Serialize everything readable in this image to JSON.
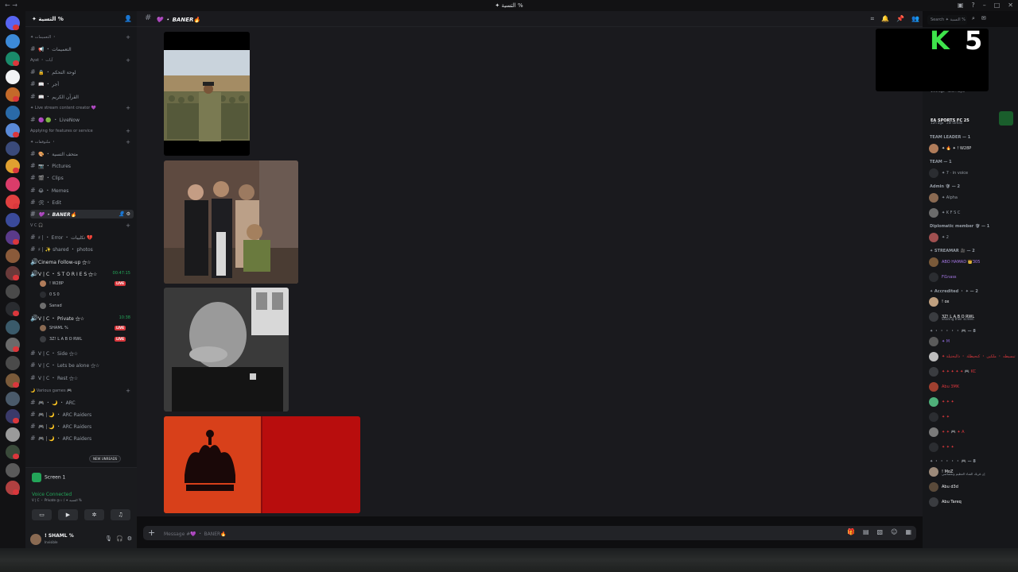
{
  "app": {
    "window_title": "✦ التسية %",
    "colors": {
      "online": "#23a559",
      "live": "#da373c",
      "bg": "#1a1a1e",
      "accent": "#5865f2"
    }
  },
  "server": {
    "name": "✦ التسية %"
  },
  "channels": [
    {
      "kind": "cat",
      "label": "✦ التعميمات ・"
    },
    {
      "kind": "ch",
      "label": "📢 ・ التعميمات"
    },
    {
      "kind": "cat",
      "label": "Ayat ・ آيات"
    },
    {
      "kind": "ch",
      "label": "🔒 ・ لوحة التحكم"
    },
    {
      "kind": "ch",
      "label": "📖 ・ أجر"
    },
    {
      "kind": "ch",
      "label": "📖 ・ القرآن الكريم"
    },
    {
      "kind": "cat",
      "label": "✦ Live stream content creator 💜"
    },
    {
      "kind": "ch",
      "label": "🟣 🟢 ・ LiveNow"
    },
    {
      "kind": "cat",
      "label": "Applying for features or service"
    },
    {
      "kind": "cat",
      "label": "✦ ملتوقفات ・"
    },
    {
      "kind": "ch",
      "label": "🎨 ・ متحف التسية"
    },
    {
      "kind": "ch",
      "label": "📷 ・ Pictures"
    },
    {
      "kind": "ch",
      "label": "🎬 ・ Clips"
    },
    {
      "kind": "ch",
      "label": "😂 ・ Memes"
    },
    {
      "kind": "ch",
      "label": "🛠 ・ Edit"
    },
    {
      "kind": "active",
      "label": "💜 ・ BANER🔥"
    },
    {
      "kind": "cat",
      "label": "V C 🎧"
    },
    {
      "kind": "ch",
      "label": "♯ | ・ Error ・ تكليبات 💔"
    },
    {
      "kind": "ch",
      "label": "♯ | ✨ shared ・ photos"
    },
    {
      "kind": "voice-hl",
      "label": "Cinema Follow-up ⚝☆"
    }
  ],
  "voice_stories": {
    "label": "V | C ・ S T O R I E S ⚝☆",
    "timer": "00:47:15"
  },
  "voice_stories_users": [
    {
      "name": "! W28P",
      "live": "LIVE",
      "color": "#b07c5a"
    },
    {
      "name": "0 S 0",
      "live": "",
      "color": "#2b2d31"
    },
    {
      "name": "Sanad",
      "live": "",
      "color": "#6e6e6e"
    }
  ],
  "voice_private": {
    "label": "V | C ・ Private ⚝☆",
    "timer": "10:38"
  },
  "voice_private_users": [
    {
      "name": "SHAML %",
      "live": "LIVE",
      "color": "#8a6a52"
    },
    {
      "name": "3Z! L A B O RWL",
      "live": "LIVE",
      "color": "#3a3c40"
    }
  ],
  "voice_more": [
    "V | C ・ Side ⚝☆",
    "V | C ・ Lets be alone ⚝☆",
    "V | C ・ Rest ⚝☆"
  ],
  "games_cat": "🌙 Various games 🎮",
  "games": [
    "🎮 ・ 🌙 ・ ARC",
    "🎮 | 🌙 ・ ARC Raiders",
    "🎮 | 🌙 ・ ARC Raiders",
    "🎮 | 🌙 ・ ARC Raiders"
  ],
  "new_unreads": "NEW UNREADS",
  "voice_panel": {
    "screen_label": "Screen 1",
    "status": "Voice Connected",
    "channel": "V | C ・ Private ⚝☆ / ✦ التسية %"
  },
  "user": {
    "name": "! SHAML %",
    "status": "Invisible"
  },
  "chat": {
    "channel_name": "💜 ・ BANER🔥",
    "placeholder": "Message #💜 ・ BANER🔥",
    "search_placeholder": "Search ✦ التسية %"
  },
  "members": {
    "activity1": {
      "time": "1mo ago",
      "label": "New Player"
    },
    "activity2": {
      "title": "EA SPORTS FC 25",
      "time": "12h ago",
      "label": "2w Streak"
    },
    "roles": [
      {
        "label": "TEAM LEADER — 1",
        "users": [
          {
            "name": "✦ 🔥 ✦ ! W28P",
            "color": "#dbdee1",
            "av": "#b07c5a"
          }
        ]
      },
      {
        "label": "TEAM — 1",
        "users": [
          {
            "name": "✦ 7 · in voice",
            "color": "#949ba4",
            "av": "#2b2d31"
          }
        ]
      },
      {
        "label": "Admin 🛡 — 2",
        "users": [
          {
            "name": "✦ Alpha",
            "color": "#949ba4",
            "av": "#8a6a52"
          },
          {
            "name": "✦ K F S C",
            "color": "#949ba4",
            "av": "#6b6b6b"
          }
        ]
      },
      {
        "label": "Diplomatic member 🛡 — 1",
        "users": [
          {
            "name": "✦ 2",
            "color": "#949ba4",
            "av": "#a05050"
          }
        ]
      },
      {
        "label": "✦ STREAMAR 🎥 — 2",
        "users": [
          {
            "name": "ABO HAMAD 👑305",
            "color": "#a779e6",
            "av": "#7a5a3a"
          },
          {
            "name": "Fi1nass",
            "color": "#a779e6",
            "av": "#2b2d31"
          }
        ]
      },
      {
        "label": "✦ Accredited ・ ✦ — 2",
        "users": [
          {
            "name": "! ox",
            "color": "#f2f3f5",
            "av": "#c0a080"
          },
          {
            "name": "3Z! L A B O RWL",
            "color": "#f2f3f5",
            "av": "#3a3c40",
            "sub": "Sharing their screen"
          }
        ]
      },
      {
        "label": "✦ ・ ・ ・ ・ ・ 🎮 — 8",
        "users": [
          {
            "name": "✦ M",
            "color": "#8d6ad8",
            "av": "#5a5a5a"
          },
          {
            "name": "✦ تبسيطه ・ ملكين ・ كنحيطلة ・ دالبحتيلة",
            "color": "#da373c",
            "av": "#bdbdbd"
          },
          {
            "name": "✦ ✦ ✦ ✦ ✦ 🎮 KC",
            "color": "#da373c",
            "av": "#3a3c40"
          },
          {
            "name": "Abu 3MK",
            "color": "#da373c",
            "av": "#a04030"
          },
          {
            "name": "✦ ✦ ✦",
            "color": "#da373c",
            "av": "#4fb07a"
          },
          {
            "name": "✦ ✦",
            "color": "#da373c",
            "av": "#2b2d31"
          },
          {
            "name": "✦ ✦ 🎮 ✦ A",
            "color": "#da373c",
            "av": "#7a7a7a"
          },
          {
            "name": "✦ ✦ ✦",
            "color": "#da373c",
            "av": "#2b2d31"
          }
        ]
      },
      {
        "label": "✦ ・ ・ ・ ・ ・ 🎮 — 8",
        "users": [
          {
            "name": "! MoZ",
            "color": "#f2f3f5",
            "av": "#9c8a7a",
            "sub": "إن قربك الشاء العظيم وتعصاصي"
          },
          {
            "name": "Abu d3d",
            "color": "#f2f3f5",
            "av": "#5a4a3a"
          },
          {
            "name": "Abu Tareq",
            "color": "#f2f3f5",
            "av": "#3a3c40"
          }
        ]
      }
    ]
  },
  "stream_overlay": {
    "k": "K",
    "n": "5"
  }
}
